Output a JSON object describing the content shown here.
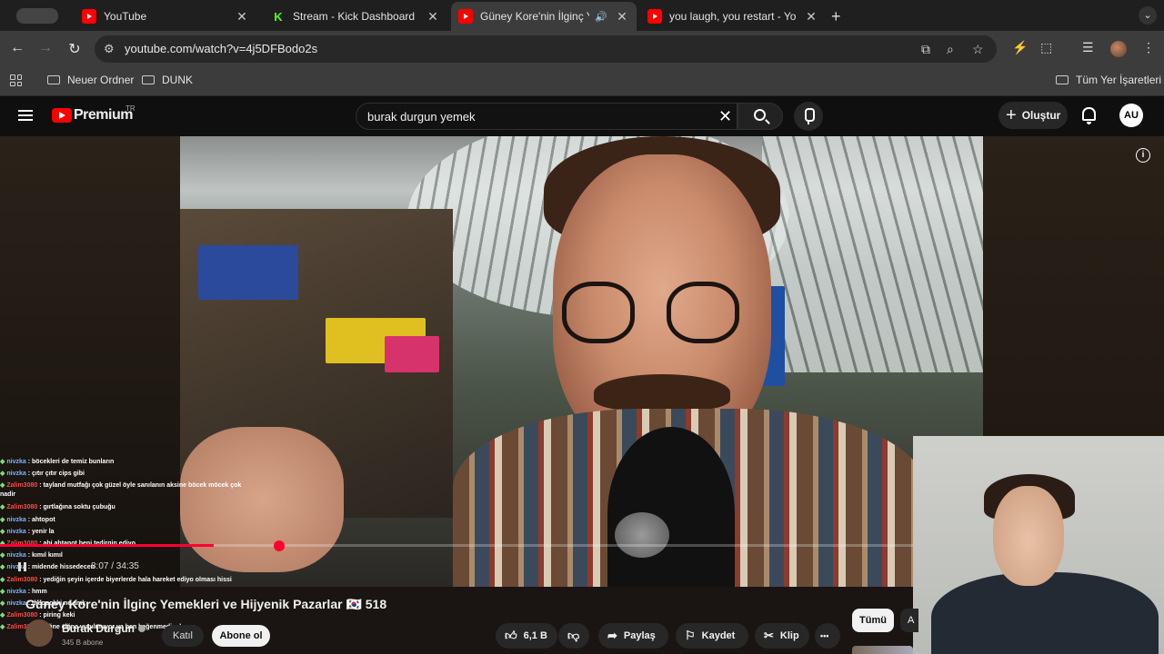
{
  "tabs": [
    {
      "label": "YouTube",
      "icon": "youtube-icon"
    },
    {
      "label": "Stream - Kick Dashboard",
      "icon": "kick-icon"
    },
    {
      "label": "Güney Kore'nin İlginç Yem",
      "icon": "youtube-icon",
      "active": true
    },
    {
      "label": "you laugh, you restart - YouTu",
      "icon": "youtube-icon"
    }
  ],
  "kick_glyph": "K",
  "address": {
    "url": "youtube.com/watch?v=4j5DFBodo2s"
  },
  "bookmarks": [
    {
      "label": "Neuer Ordner"
    },
    {
      "label": "DUNK"
    }
  ],
  "bookmarks_all": "Tüm Yer İşaretleri",
  "yt": {
    "brand": "Premium",
    "region": "TR",
    "search_value": "burak durgun yemek",
    "create_label": "Oluştur",
    "account_initials": "AU"
  },
  "chat": [
    {
      "user": "nivzka",
      "text": ": böcekleri de temiz bunların",
      "color": "blue"
    },
    {
      "user": "nivzka",
      "text": ": çıtır çıtır cips gibi",
      "color": "blue"
    },
    {
      "user": "Zalim3080",
      "text": ": tayland mutfağı çok güzel öyle sanılanın aksine böcek möcek çok nadir",
      "color": "red",
      "wrap": true
    },
    {
      "user": "Zalim3080",
      "text": ": gırtlağına soktu çubuğu",
      "color": "red"
    },
    {
      "user": "nivzka",
      "text": ": ahtopot",
      "color": "blue"
    },
    {
      "user": "nivzka",
      "text": ": yenir la",
      "color": "blue"
    },
    {
      "user": "Zalim3080",
      "text": ": abi ahtapot beni tedirgin ediyo",
      "color": "red"
    },
    {
      "user": "nivzka",
      "text": ": kımıl kımıl",
      "color": "blue"
    },
    {
      "user": "nivzka",
      "text": ": midende hissedecen",
      "color": "blue"
    },
    {
      "user": "Zalim3080",
      "text": ": yediğin şeyin içerde biyerlerde hala hareket ediyo olması hissi",
      "color": "red"
    },
    {
      "user": "nivzka",
      "text": ": hmm",
      "color": "blue"
    },
    {
      "user": "nivzka",
      "text": ": theopokki ne amk",
      "color": "blue"
    },
    {
      "user": "Zalim3080",
      "text": ": piring keki",
      "color": "red"
    },
    {
      "user": "Zalim3080",
      "text": ": çiğne çiğne yutulmuyor ya ben beğenmedim bunu",
      "color": "red"
    }
  ],
  "player": {
    "time": "8:07 / 34:35",
    "progress": 0.234
  },
  "video": {
    "title": "Güney Kore'nin İlginç Yemekleri ve Hijyenik Pazarlar 🇰🇷 518",
    "channel": "Burak Durgun",
    "subs": "345 B abone",
    "join_label": "Katıl",
    "subscribe_label": "Abone ol",
    "likes": "6,1 B",
    "share_label": "Paylaş",
    "save_label": "Kaydet",
    "clip_label": "Klip",
    "more_label": "•••"
  },
  "chips": {
    "all": "Tümü",
    "next": "A"
  },
  "colors": {
    "accent": "#ff0033",
    "youtube_red": "#ff0000",
    "kick_green": "#53fc18"
  }
}
